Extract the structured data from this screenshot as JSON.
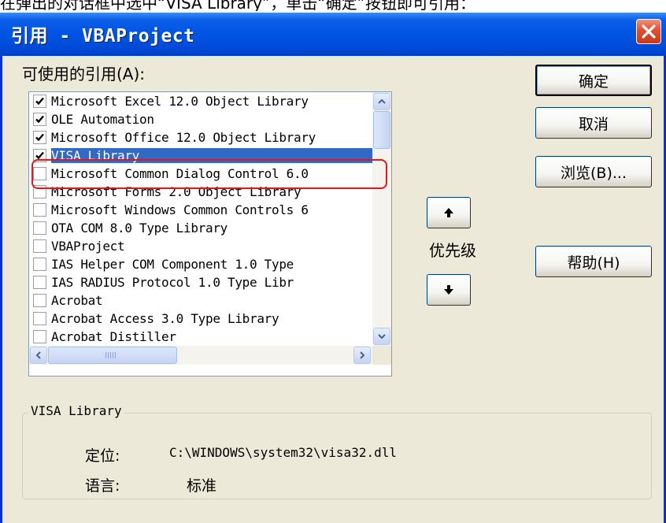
{
  "caption": "在弹出的对话框中选中“VISA Library”，单击“确定”按钮即可引用：",
  "dialog": {
    "title": "引用 - VBAProject"
  },
  "available_refs_label": "可使用的引用(A):",
  "references": [
    {
      "label": "Microsoft Excel 12.0 Object Library",
      "checked": true
    },
    {
      "label": "OLE Automation",
      "checked": true
    },
    {
      "label": "Microsoft Office 12.0 Object Library",
      "checked": true
    },
    {
      "label": "VISA Library",
      "checked": true,
      "selected": true
    },
    {
      "label": "Microsoft Common Dialog Control 6.0",
      "checked": false
    },
    {
      "label": "Microsoft Forms 2.0 Object Library",
      "checked": false
    },
    {
      "label": "Microsoft Windows Common Controls 6",
      "checked": false
    },
    {
      "label": "OTA COM 8.0 Type Library",
      "checked": false
    },
    {
      "label": "VBAProject",
      "checked": false
    },
    {
      "label": " IAS Helper COM Component 1.0 Type",
      "checked": false
    },
    {
      "label": " IAS RADIUS Protocol 1.0 Type Libr",
      "checked": false
    },
    {
      "label": "Acrobat",
      "checked": false
    },
    {
      "label": "Acrobat Access 3.0 Type Library",
      "checked": false
    },
    {
      "label": "Acrobat Distiller",
      "checked": false
    }
  ],
  "buttons": {
    "ok": "确定",
    "cancel": "取消",
    "browse": "浏览(B)...",
    "help": "帮助(H)"
  },
  "priority_label": "优先级",
  "details": {
    "group_title": "VISA Library",
    "location_label": "定位:",
    "location_value": "C:\\WINDOWS\\system32\\visa32.dll",
    "language_label": "语言:",
    "language_value": "标准"
  },
  "colors": {
    "titlebar": "#0054e3",
    "selection": "#316ac5",
    "highlight_ring": "#e8141c",
    "dialog_bg": "#ece9d8"
  },
  "icons": {
    "close": "close-icon",
    "up": "arrow-up-icon",
    "down": "arrow-down-icon",
    "check": "checkmark-icon"
  }
}
